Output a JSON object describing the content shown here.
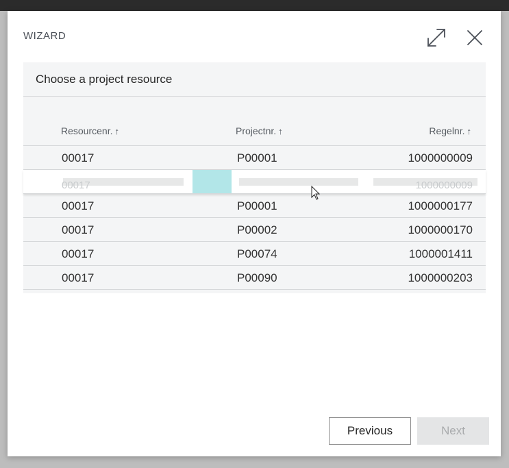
{
  "dialog": {
    "title": "WIZARD",
    "expand_icon": "expand-icon",
    "close_icon": "close-icon"
  },
  "panel": {
    "heading": "Choose a project resource"
  },
  "table": {
    "columns": [
      {
        "label": "Resourcenr.",
        "sort": "ascending"
      },
      {
        "label": "Projectnr.",
        "sort": "ascending"
      },
      {
        "label": "Regelnr.",
        "sort": "ascending"
      }
    ],
    "sort_arrow": "↑",
    "rows": [
      {
        "resource": "00017",
        "project": "P00001",
        "regel": "1000000009",
        "selected": false
      },
      {
        "resource": "00017",
        "project": "",
        "regel": "1000000009",
        "selected": true
      },
      {
        "resource": "00017",
        "project": "P00001",
        "regel": "1000000177",
        "selected": false
      },
      {
        "resource": "00017",
        "project": "P00002",
        "regel": "1000000170",
        "selected": false
      },
      {
        "resource": "00017",
        "project": "P00074",
        "regel": "1000001411",
        "selected": false
      },
      {
        "resource": "00017",
        "project": "P00090",
        "regel": "1000000203",
        "selected": false
      }
    ]
  },
  "footer": {
    "previous_label": "Previous",
    "next_label": "Next",
    "next_enabled": false
  },
  "colors": {
    "selection_highlight": "#b2e6e8",
    "panel_background": "#f4f5f6",
    "disabled_button": "#e4e5e6"
  }
}
